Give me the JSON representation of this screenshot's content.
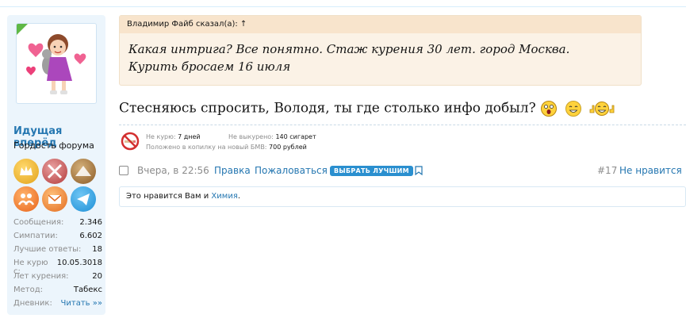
{
  "user": {
    "name": "Идущая вперёд",
    "title": "Гордость форума",
    "stats": [
      {
        "label": "Сообщения:",
        "value": "2.346"
      },
      {
        "label": "Симпатии:",
        "value": "6.602"
      },
      {
        "label": "Лучшие ответы:",
        "value": "18"
      },
      {
        "label": "Не курю с:",
        "value": "10.05.3018"
      },
      {
        "label": "Лет курения:",
        "value": "20"
      },
      {
        "label": "Метод:",
        "value": "Табекс"
      },
      {
        "label": "Дневник:",
        "value": "Читать »»"
      }
    ]
  },
  "quote": {
    "author": "Владимир Файб сказал(а): ↑",
    "text": "Какая интрига? Все понятно. Стаж курения 30 лет. город Москва. Курить бросаем 16 июля"
  },
  "message": {
    "text": "Стесняюсь спросить, Володя, ты где столько инфо добыл?"
  },
  "signature": {
    "no_smoke_label": "Не курю:",
    "no_smoke_value": "7 дней",
    "not_smoked_label": "Не выкурено:",
    "not_smoked_value": "140 сигарет",
    "saved_label": "Положено в копилку на новый БМВ:",
    "saved_value": "700 рублей"
  },
  "actions": {
    "date": "Вчера, в 22:56",
    "edit": "Правка",
    "report": "Пожаловаться",
    "best": "ВЫБРАТЬ ЛУЧШИМ",
    "post_number": "#17",
    "dislike": "Не нравится"
  },
  "likes": {
    "prefix": "Это нравится Вам и ",
    "user": "Химия",
    "suffix": "."
  },
  "colors": {
    "link": "#2577b1",
    "quote_bg": "#fbf2e6",
    "sidebar_bg": "#ecf5fc",
    "best_button": "#2a8fcf"
  }
}
